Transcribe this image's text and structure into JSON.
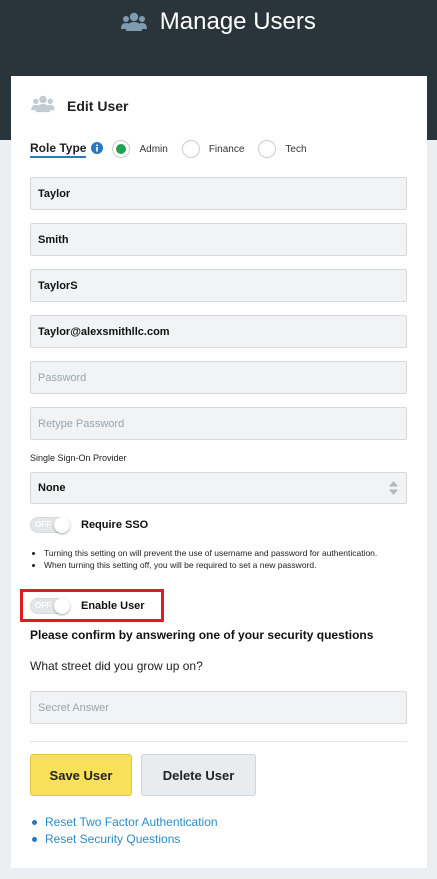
{
  "header": {
    "title": "Manage Users",
    "icon": "users-icon"
  },
  "card": {
    "title": "Edit User",
    "icon": "users-icon"
  },
  "role": {
    "label": "Role Type",
    "options": [
      {
        "label": "Admin",
        "selected": true
      },
      {
        "label": "Finance",
        "selected": false
      },
      {
        "label": "Tech",
        "selected": false
      }
    ]
  },
  "fields": {
    "first_name": "Taylor",
    "last_name": "Smith",
    "username": "TaylorS",
    "email": "Taylor@alexsmithllc.com",
    "password_placeholder": "Password",
    "retype_placeholder": "Retype Password"
  },
  "sso": {
    "label": "Single Sign-On Provider",
    "selected": "None",
    "require_label": "Require SSO",
    "require_state": "OFF",
    "notes": [
      "Turning this setting on will prevent the use of username and password for authentication.",
      "When turning this setting off, you will be required to set a new password."
    ]
  },
  "enable_user": {
    "label": "Enable User",
    "state": "OFF"
  },
  "security": {
    "prompt": "Please confirm by answering one of your security questions",
    "question": "What street did you grow up on?",
    "answer_placeholder": "Secret Answer"
  },
  "buttons": {
    "save": "Save User",
    "delete": "Delete User"
  },
  "links": [
    "Reset Two Factor Authentication",
    "Reset Security Questions"
  ],
  "colors": {
    "header_bg": "#2a353b",
    "accent_green": "#22a052",
    "save_yellow": "#f8e158",
    "link_blue": "#2a8cc7",
    "highlight_red": "#e01b24"
  }
}
